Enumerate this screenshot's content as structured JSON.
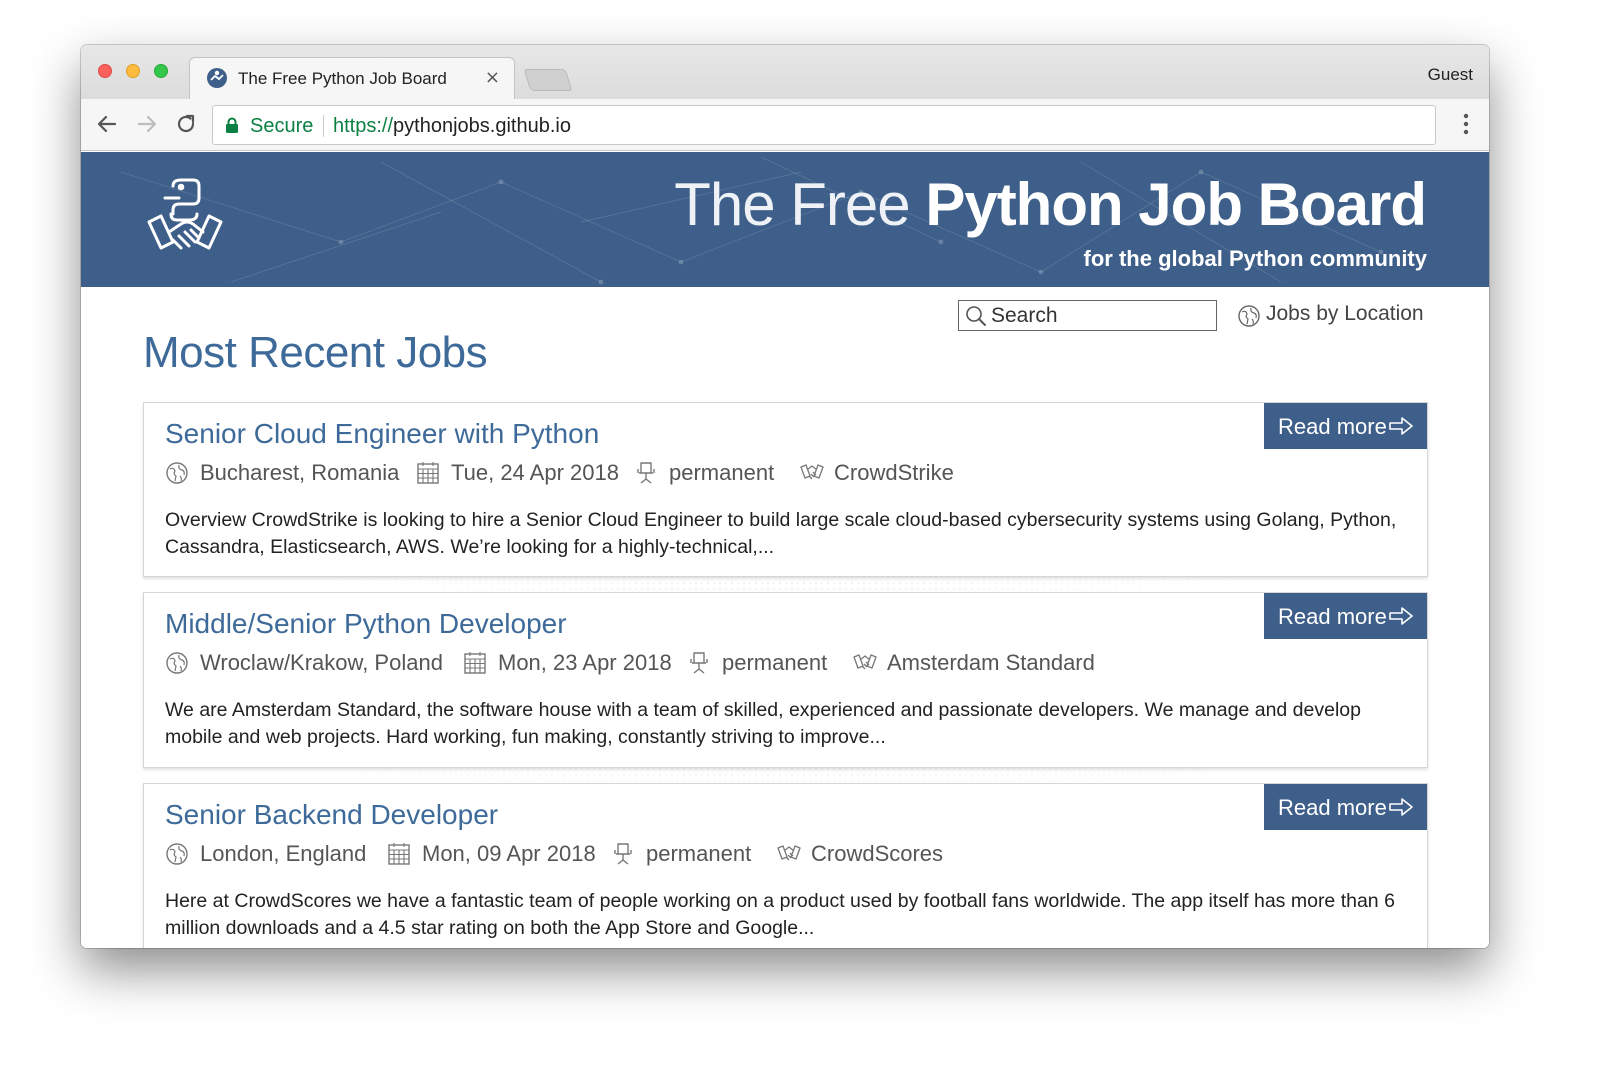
{
  "browser": {
    "tab_title": "The Free Python Job Board",
    "tab_close": "×",
    "profile": "Guest",
    "secure_label": "Secure",
    "url_scheme": "https://",
    "url_host": "pythonjobs.github.io"
  },
  "header": {
    "title_light": "The Free",
    "title_bold": "Python Job Board",
    "tagline": "for the global Python community"
  },
  "toolbar": {
    "search_placeholder": "Search",
    "location_link": "Jobs by Location"
  },
  "main": {
    "heading": "Most Recent Jobs",
    "read_more_label": "Read more",
    "jobs": [
      {
        "title": "Senior Cloud Engineer with Python",
        "location": "Bucharest, Romania",
        "date": "Tue, 24 Apr 2018",
        "type": "permanent",
        "company": "CrowdStrike",
        "description": "Overview CrowdStrike is looking to hire a Senior Cloud Engineer to build large scale cloud-based cybersecurity systems using Golang, Python, Cassandra, Elasticsearch, AWS. We’re looking for a highly-technical,..."
      },
      {
        "title": "Middle/Senior Python Developer",
        "location": "Wroclaw/Krakow, Poland",
        "date": "Mon, 23 Apr 2018",
        "type": "permanent",
        "company": "Amsterdam Standard",
        "description": "We are Amsterdam Standard, the software house with a team of skilled, experienced and passionate developers. We manage and develop mobile and web projects. Hard working, fun making, constantly striving to improve..."
      },
      {
        "title": "Senior Backend Developer",
        "location": "London, England",
        "date": "Mon, 09 Apr 2018",
        "type": "permanent",
        "company": "CrowdScores",
        "description": "Here at CrowdScores we have a fantastic team of people working on a product used by football fans worldwide. The app itself has more than 6 million downloads and a 4.5 star rating on both the App Store and Google..."
      }
    ]
  },
  "colors": {
    "banner": "#3e5f89",
    "link": "#3e6a9a",
    "secure_green": "#0b8043"
  },
  "icons": [
    "python-handshake-logo-icon",
    "search-icon",
    "globe-icon",
    "calendar-icon",
    "chair-icon",
    "handshake-icon",
    "arrow-right-icon",
    "lock-icon",
    "back-arrow-icon",
    "forward-arrow-icon",
    "reload-icon",
    "menu-dots-icon",
    "close-icon"
  ]
}
